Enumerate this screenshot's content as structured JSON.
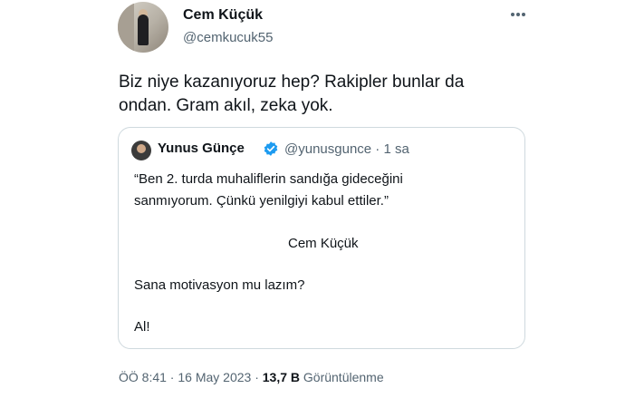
{
  "author": {
    "name": "Cem Küçük",
    "handle": "@cemkucuk55"
  },
  "more_icon": "more-horizontal-icon",
  "tweet": {
    "line1": "Biz niye kazanıyoruz hep? Rakipler bunlar da",
    "line2": "ondan. Gram akıl, zeka yok."
  },
  "quote": {
    "name": "Yunus Günçe",
    "meta": "@yunusgunce · 1 sa",
    "verified_color": "#1d9bf0",
    "lines": [
      "“Ben 2. turda muhaliflerin sandığa gideceğini",
      "sanmıyorum. Çünkü yenilgiyi kabul ettiler.”",
      "Cem Küçük",
      "Sana motivasyon mu lazım?",
      "Al!"
    ]
  },
  "footer": {
    "time_date": "ÖÖ 8:41 · 16 May 2023 · ",
    "views_count": "13,7 B",
    "views_label": " Görüntülenme"
  }
}
